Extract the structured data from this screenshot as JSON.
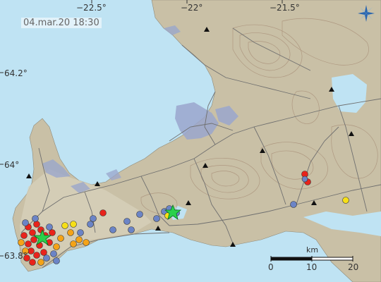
{
  "timestamp": "04.mar.20  18:30",
  "longitude_labels": [
    {
      "id": "lon-22-5",
      "text": "−22.5°"
    },
    {
      "id": "lon-22",
      "text": "−22°"
    },
    {
      "id": "lon-21-5",
      "text": "−21.5°"
    }
  ],
  "latitude_labels": [
    {
      "id": "lat-64-2",
      "text": "64.2°"
    },
    {
      "id": "lat-64",
      "text": "64°"
    },
    {
      "id": "lat-63-8",
      "text": "63.8°"
    }
  ],
  "scale_bar": {
    "unit": "km",
    "ticks": [
      "0",
      "10",
      "20"
    ]
  },
  "colors": {
    "sea": "#bfe3f3",
    "land": "#c9c0a6",
    "lowland": "#d8d3be",
    "glacier": "#9aa6cc",
    "road": "#6f6f6f",
    "contour": "#a88f78",
    "quake_red": "#e8231b",
    "quake_orange": "#f4a318",
    "quake_yellow": "#f6df17",
    "quake_blue": "#6b84c6",
    "star": "#2ad14b"
  },
  "legend_logo": "vedur-logo-icon"
}
